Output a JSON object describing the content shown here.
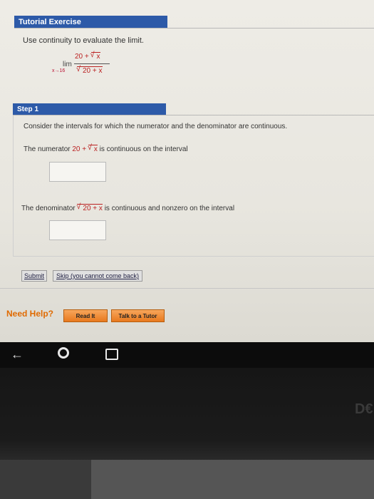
{
  "header": {
    "title": "Tutorial Exercise"
  },
  "prompt": "Use continuity to evaluate the limit.",
  "limit": {
    "word": "lim",
    "subscript": "x→16",
    "numerator": "20 + ",
    "numerator_radicand": "x",
    "denominator_radicand": "20 + x"
  },
  "step": {
    "title": "Step 1",
    "instruction": "Consider the intervals for which the numerator and the denominator are continuous.",
    "numerator_prefix": "The numerator ",
    "numerator_expr": "20 + ",
    "numerator_radicand": "x",
    "numerator_suffix": " is continuous on the interval",
    "denominator_prefix": "The denominator ",
    "denominator_radicand": "20 + x",
    "denominator_suffix": " is continuous and nonzero on the interval",
    "answer1": "",
    "answer2": ""
  },
  "actions": {
    "submit_label": "Submit",
    "skip_label": "Skip (you cannot come back)"
  },
  "help": {
    "label": "Need Help?",
    "read_label": "Read It",
    "tutor_label": "Talk to a Tutor"
  },
  "device": {
    "back_icon": "back-arrow-icon",
    "home_icon": "home-circle-icon",
    "recent_icon": "recent-apps-icon",
    "logo_text": "D€"
  },
  "colors": {
    "header_blue": "#2d5aa8",
    "math_red": "#b22222",
    "help_orange": "#e06a00"
  }
}
